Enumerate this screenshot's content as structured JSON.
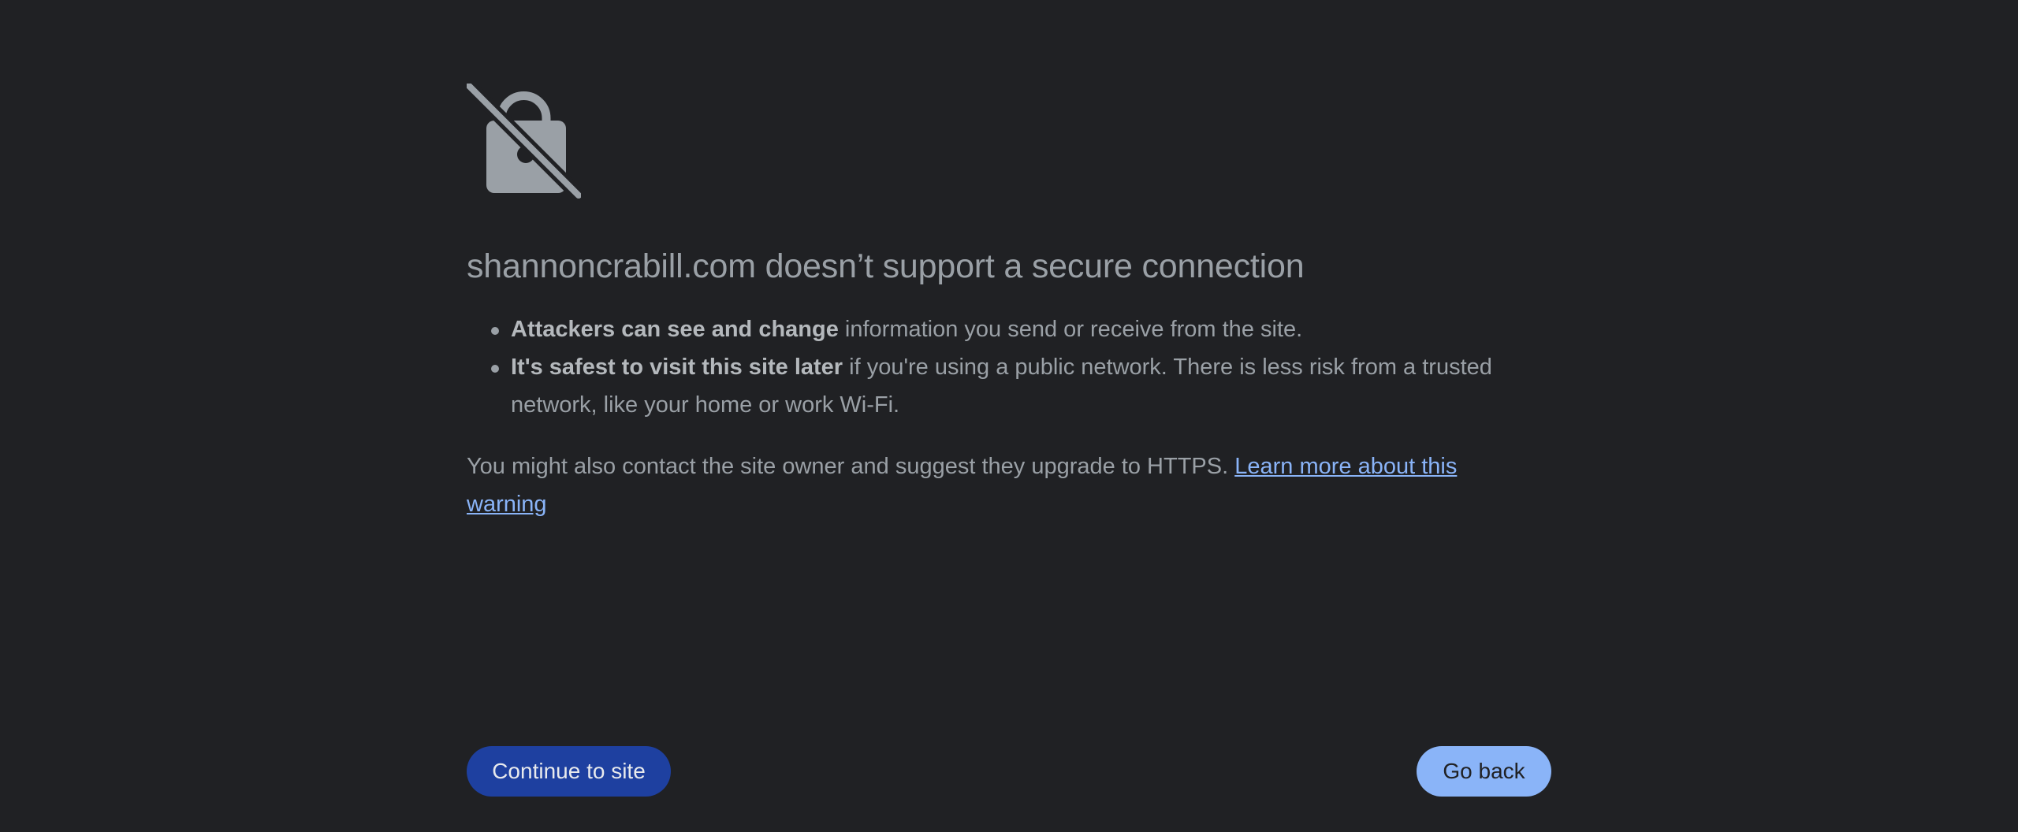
{
  "icon": "lock-slash-icon",
  "colors": {
    "background": "#202124",
    "text": "#9aa0a6",
    "link": "#8ab4f8",
    "primary_button": "#1e40a0",
    "secondary_button": "#8ab4f8"
  },
  "heading": "shannoncrabill.com doesn’t support a secure connection",
  "bullets": [
    {
      "bold": "Attackers can see and change",
      "rest": " information you send or receive from the site."
    },
    {
      "bold": "It's safest to visit this site later",
      "rest": " if you're using a public network. There is less risk from a trusted network, like your home or work Wi-Fi."
    }
  ],
  "paragraph": {
    "text": "You might also contact the site owner and suggest they upgrade to HTTPS. ",
    "link": "Learn more about this warning"
  },
  "buttons": {
    "continue": "Continue to site",
    "back": "Go back"
  }
}
